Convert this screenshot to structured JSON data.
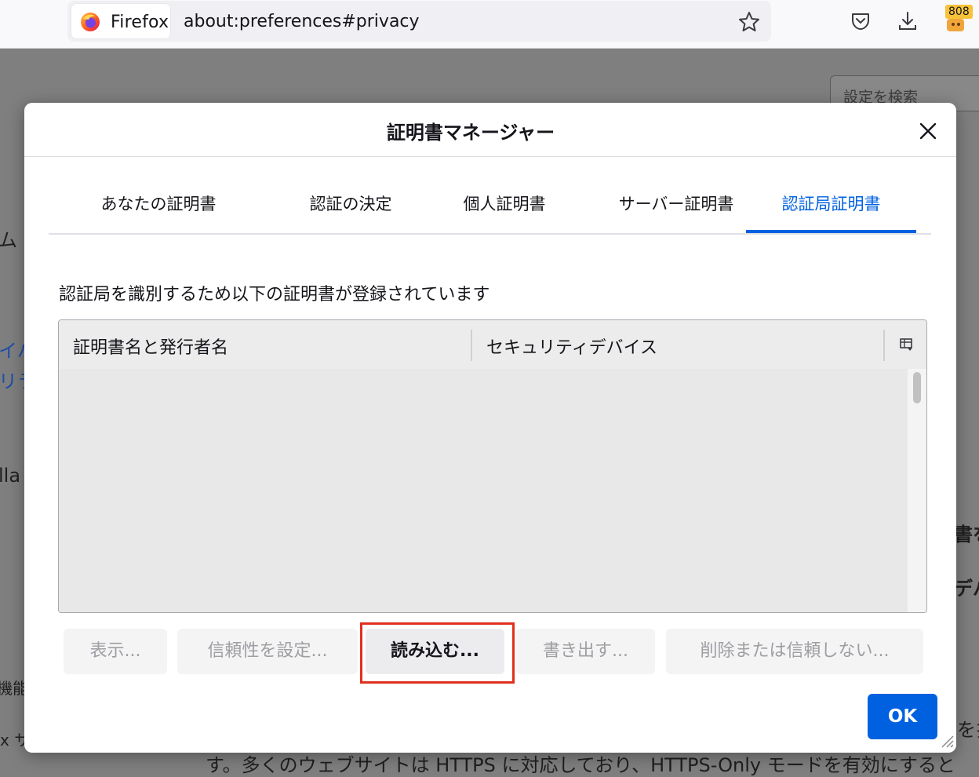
{
  "browser": {
    "identity_label": "Firefox",
    "url": "about:preferences#privacy",
    "extension_badge": "808",
    "icons": [
      "firefox-logo-icon",
      "bookmark-star-icon",
      "pocket-icon",
      "download-icon",
      "extension-icon"
    ]
  },
  "page": {
    "search_placeholder": "設定を検索",
    "fragments": {
      "f1": "ム",
      "f2": "イハ",
      "f3": "リラ",
      "f4": "lla",
      "f5": "書を",
      "f6": "デバ",
      "f7": "機能",
      "f8": "x サ",
      "f9": "を扌",
      "f10": "す。多くのウェブサイトは HTTPS に対応しており、HTTPS-Only モードを有効にすると"
    }
  },
  "dialog": {
    "title": "証明書マネージャー",
    "tabs": [
      {
        "label": "あなたの証明書",
        "selected": false
      },
      {
        "label": "認証の決定",
        "selected": false
      },
      {
        "label": "個人証明書",
        "selected": false
      },
      {
        "label": "サーバー証明書",
        "selected": false
      },
      {
        "label": "認証局証明書",
        "selected": true
      }
    ],
    "description": "認証局を識別するため以下の証明書が登録されています",
    "columns": [
      "証明書名と発行者名",
      "セキュリティデバイス"
    ],
    "buttons": {
      "view": "表示...",
      "trust": "信頼性を設定...",
      "import": "読み込む...",
      "export": "書き出す...",
      "delete": "削除または信頼しない..."
    },
    "ok": "OK",
    "accent_color": "#0061e0",
    "highlight_color": "#e0301e"
  }
}
